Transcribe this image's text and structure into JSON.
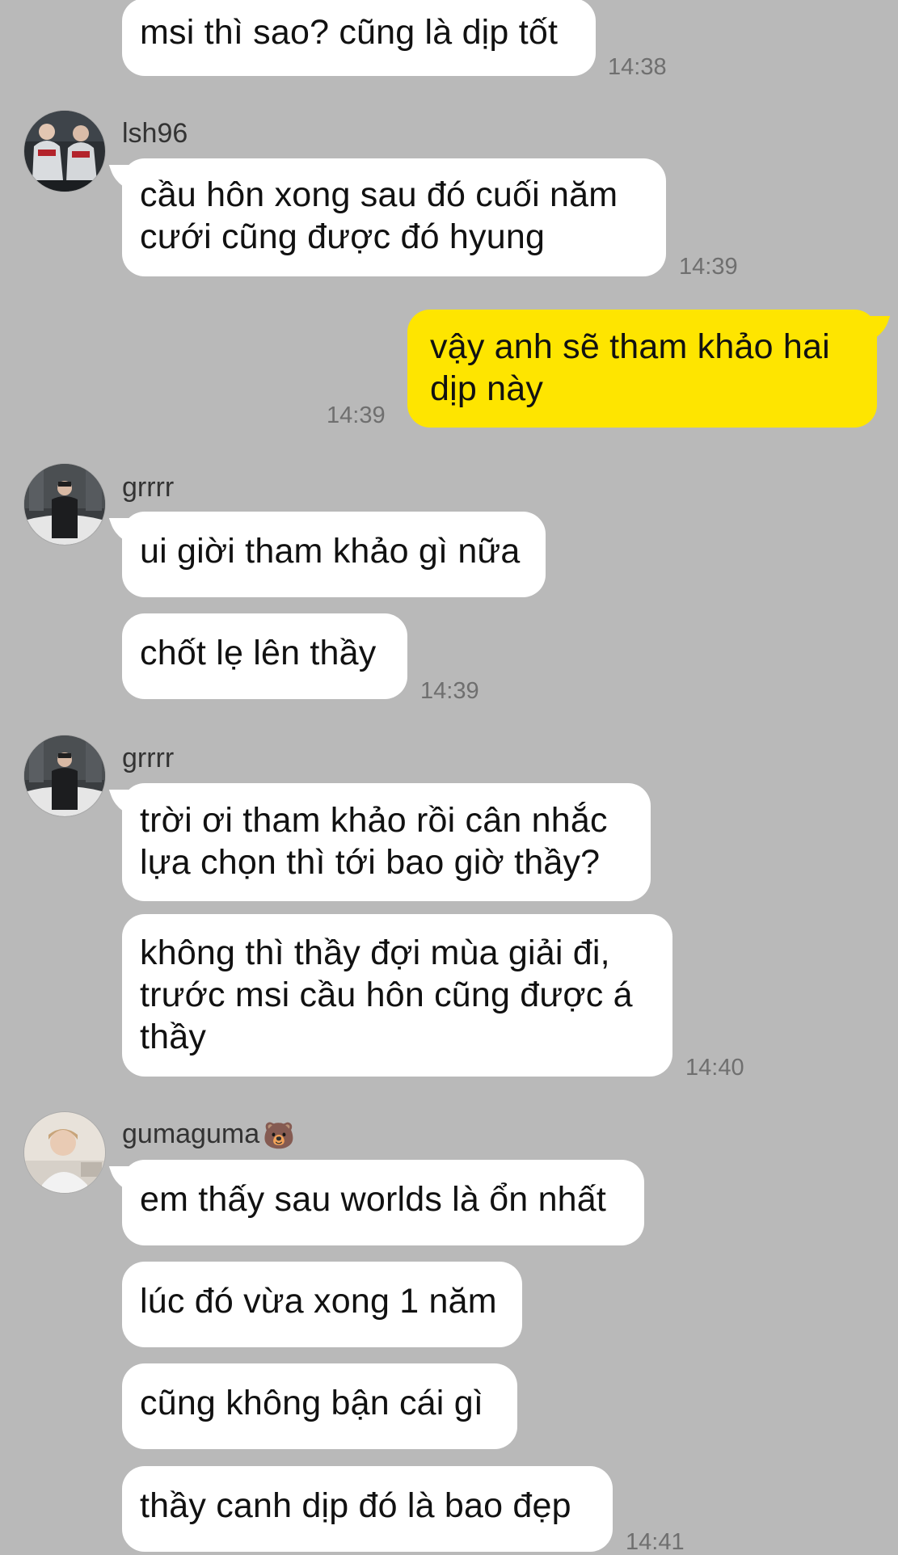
{
  "messages": [
    {
      "text": "msi thì sao? cũng là dịp tốt"
    },
    {
      "sender": "lsh96",
      "lines": [
        "cầu hôn xong sau đó cuối năm",
        "cưới cũng được đó hyung"
      ]
    },
    {
      "lines": [
        "vậy anh sẽ tham khảo hai",
        "dịp này"
      ]
    },
    {
      "sender": "grrrr",
      "text": "ui giời tham khảo gì nữa"
    },
    {
      "text": "chốt lẹ lên thầy"
    },
    {
      "sender": "grrrr",
      "lines": [
        "trời ơi tham khảo rồi cân nhắc",
        "lựa chọn thì tới bao giờ thầy?"
      ]
    },
    {
      "lines": [
        "không thì thầy đợi mùa giải đi,",
        "trước msi cầu hôn cũng được á",
        "thầy"
      ]
    },
    {
      "sender": "gumaguma",
      "sender_emoji": "🐻",
      "text": "em thấy sau worlds là ổn nhất"
    },
    {
      "text": "lúc đó vừa xong 1 năm"
    },
    {
      "text": "cũng không bận cái gì"
    },
    {
      "text": "thầy canh dịp đó là bao đẹp"
    }
  ],
  "times": [
    "14:38",
    "14:39",
    "14:39",
    "14:39",
    "14:40",
    "14:41"
  ],
  "avatars": {
    "lsh96": "avatar-two-players",
    "grrrr": "avatar-person-in-snow",
    "gumaguma": "avatar-person-portrait"
  },
  "colors": {
    "background": "#b9b9b9",
    "incoming_bubble": "#ffffff",
    "outgoing_bubble": "#fee500",
    "timestamp": "#6f6f6f"
  }
}
